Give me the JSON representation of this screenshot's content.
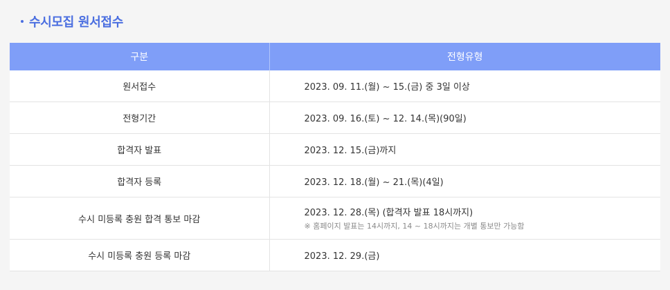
{
  "section": {
    "title": "수시모집 원서접수"
  },
  "table": {
    "headers": [
      "구분",
      "전형유형"
    ],
    "rows": [
      {
        "label": "원서접수",
        "value": "2023. 09. 11.(월) ~ 15.(금) 중 3일 이상"
      },
      {
        "label": "전형기간",
        "value": "2023. 09. 16.(토) ~ 12. 14.(목)(90일)"
      },
      {
        "label": "합격자 발표",
        "value": "2023. 12. 15.(금)까지"
      },
      {
        "label": "합격자 등록",
        "value": "2023. 12. 18.(월) ~ 21.(목)(4일)"
      },
      {
        "label": "수시 미등록 충원 합격 통보 마감",
        "value": "2023. 12. 28.(목) (합격자 발표 18시까지)",
        "note": "※ 홈페이지 발표는 14시까지, 14 ~ 18시까지는 개별 통보만 가능함"
      },
      {
        "label": "수시 미등록 충원 등록 마감",
        "value": "2023. 12. 29.(금)"
      }
    ]
  }
}
